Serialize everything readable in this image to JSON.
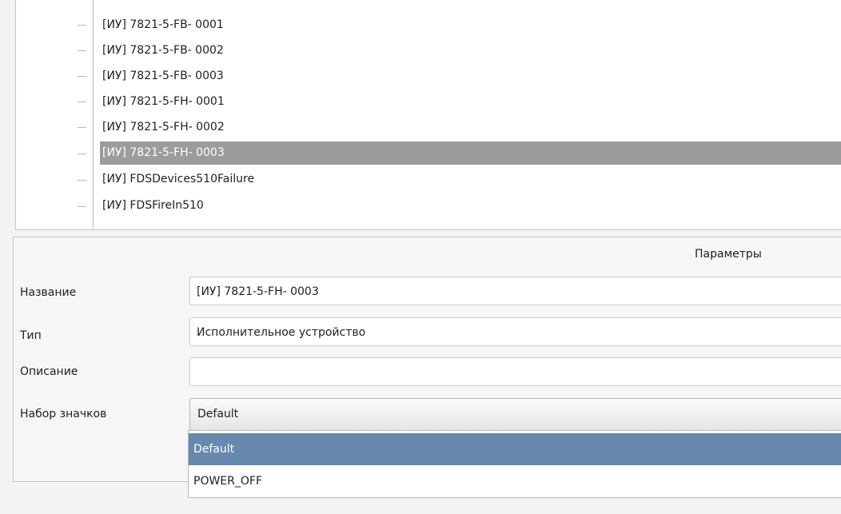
{
  "tree": {
    "items": [
      {
        "label": "[ИУ] 7821-5-FB- 0001"
      },
      {
        "label": "[ИУ] 7821-5-FB- 0002"
      },
      {
        "label": "[ИУ] 7821-5-FB- 0003"
      },
      {
        "label": "[ИУ] 7821-5-FH- 0001"
      },
      {
        "label": "[ИУ] 7821-5-FH- 0002"
      },
      {
        "label": "[ИУ] 7821-5-FH- 0003",
        "selected": true
      },
      {
        "label": "[ИУ] FDSDevices510Failure"
      },
      {
        "label": "[ИУ] FDSFireIn510"
      }
    ]
  },
  "params": {
    "header": "Параметры",
    "name_label": "Название",
    "name_value": "[ИУ] 7821-5-FH- 0003",
    "type_label": "Тип",
    "type_value": "Исполнительное устройство",
    "description_label": "Описание",
    "description_value": "",
    "iconset_label": "Набор значков",
    "iconset_value": "Default",
    "iconset_options": [
      {
        "label": "Default",
        "selected": true
      },
      {
        "label": "POWER_OFF"
      }
    ]
  },
  "colors": {
    "tree_selection": "#9c9c9c",
    "dropdown_selection": "#6689ad"
  }
}
